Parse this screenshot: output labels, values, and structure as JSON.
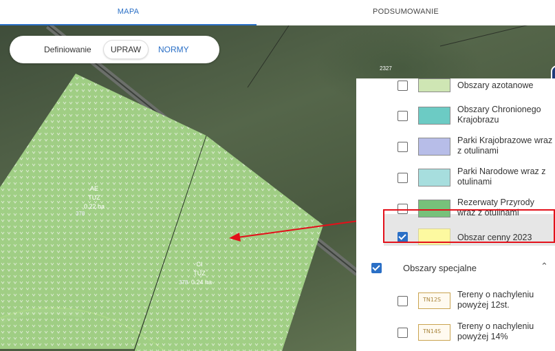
{
  "tabs": {
    "map": "MAPA",
    "summary": "PODSUMOWANIE"
  },
  "toolbar": {
    "label": "Definiowanie",
    "button1": "UPRAW",
    "button2": "NORMY"
  },
  "parcels": [
    {
      "code": "AE",
      "use": "TUZ",
      "area": "0.22 ba",
      "number": "378"
    },
    {
      "code": "CI",
      "use": "TUZ",
      "area": "0.24 ha",
      "number": "378"
    }
  ],
  "map_label": "2327",
  "layers": [
    {
      "label": "Obszary azotanowe",
      "color": "#cfe6b4",
      "checked": false
    },
    {
      "label": "Obszary Chronionego Krajobrazu",
      "color": "#6ccbc4",
      "checked": false
    },
    {
      "label": "Parki Krajobrazowe wraz z otulinami",
      "color": "#b7bde8",
      "checked": false
    },
    {
      "label": "Parki Narodowe wraz z otulinami",
      "color": "#a7dede",
      "checked": false
    },
    {
      "label": "Rezerwaty Przyrody wraz z otulinami",
      "color": "#77c17a",
      "checked": false
    },
    {
      "label": "Obszar cenny 2023",
      "color": "#fdf9a0",
      "checked": true
    }
  ],
  "special_section": {
    "label": "Obszary specjalne",
    "checked": true
  },
  "special_layers": [
    {
      "label": "Tereny o nachyleniu powyżej 12st.",
      "symbol": "TN12S",
      "checked": false
    },
    {
      "label": "Tereny o nachyleniu powyżej 14%",
      "symbol": "TN14S",
      "checked": false
    }
  ],
  "colors": {
    "accent": "#2a6fc6",
    "highlight": "#e3101a"
  }
}
